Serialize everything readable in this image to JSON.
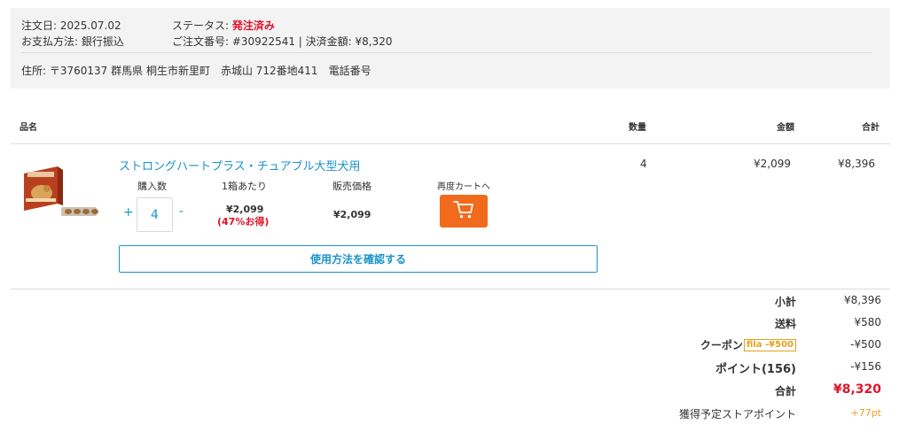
{
  "order_info": {
    "order_date_label": "注文日:",
    "order_date": "2025.07.02",
    "payment_label": "お支払方法:",
    "payment_method": "銀行振込",
    "status_label": "ステータス:",
    "status_value": "発注済み",
    "order_number_text": "ご注文番号: #30922541 | 決済金額: ¥8,320",
    "address_label": "住所:",
    "address": "〒3760137 群馬県 桐生市新里町　赤城山 712番地411　電話番号"
  },
  "table_header": {
    "product": "品名",
    "quantity": "数量",
    "amount": "金額",
    "total": "合計"
  },
  "product": {
    "name": "ストロングハートプラス・チュアブル大型犬用",
    "purchase_qty_label": "購入数",
    "per_box_label": "1箱あたり",
    "selling_price_label": "販売価格",
    "recart_label": "再度カートへ",
    "qty_plus": "+",
    "qty_minus": "-",
    "qty_value": "4",
    "per_box_price": "¥2,099",
    "discount_text": "(47%お得)",
    "selling_price": "¥2,099",
    "usage_button": "使用方法を確認する",
    "quantity": "4",
    "amount": "¥2,099",
    "total": "¥8,396"
  },
  "summary": {
    "subtotal_label": "小計",
    "subtotal_value": "¥8,396",
    "shipping_label": "送料",
    "shipping_value": "¥580",
    "coupon_label": "クーポン",
    "coupon_tag": "fila -¥500",
    "coupon_value": "-¥500",
    "points_label": "ポイント(156)",
    "points_value": "-¥156",
    "total_label": "合計",
    "total_value": "¥8,320",
    "store_points_label": "獲得予定ストアポイント",
    "store_points_value": "+77pt"
  },
  "colors": {
    "accent_blue": "#1a93c8",
    "status_red": "#e0142b",
    "cart_orange": "#f26a1b",
    "coupon_gold": "#e0a21c"
  }
}
